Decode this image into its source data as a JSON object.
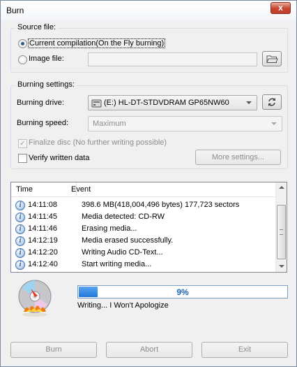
{
  "window": {
    "title": "Burn",
    "close_glyph": "x"
  },
  "source": {
    "group_label": "Source file:",
    "current_label": "Current compilation(On the Fly burning)",
    "image_label": "Image file:",
    "image_value": "",
    "selected": "current"
  },
  "burning": {
    "group_label": "Burning settings:",
    "drive_label": "Burning drive:",
    "drive_value": "(E:) HL-DT-STDVDRAM GP65NW60",
    "speed_label": "Burning speed:",
    "speed_value": "Maximum",
    "finalize_label": "Finalize disc (No further writing possible)",
    "finalize_checked": true,
    "verify_label": "Verify written data",
    "verify_checked": false,
    "more_settings_label": "More settings..."
  },
  "log": {
    "columns": [
      "Time",
      "Event"
    ],
    "rows": [
      {
        "time": "14:11:08",
        "event": "398.6 MB(418,004,496 bytes)  177,723 sectors"
      },
      {
        "time": "14:11:45",
        "event": "Media detected: CD-RW"
      },
      {
        "time": "14:11:46",
        "event": "Erasing media..."
      },
      {
        "time": "14:12:19",
        "event": "Media erased successfully."
      },
      {
        "time": "14:12:20",
        "event": "Writing Audio CD-Text..."
      },
      {
        "time": "14:12:40",
        "event": "Start writing media..."
      }
    ]
  },
  "progress": {
    "value": 0.09,
    "label": "9%"
  },
  "status_text": "Writing... I Won't Apologize",
  "buttons": {
    "burn": "Burn",
    "abort": "Abort",
    "exit": "Exit"
  },
  "icons": {
    "drive": "drive-icon",
    "folder": "folder-icon",
    "refresh": "refresh-icon",
    "info": "info-icon",
    "disc": "disc-icon"
  },
  "colors": {
    "progress_fill": "#1f78d8",
    "progress_text": "#1a5fb4",
    "close_button": "#c7432f"
  }
}
